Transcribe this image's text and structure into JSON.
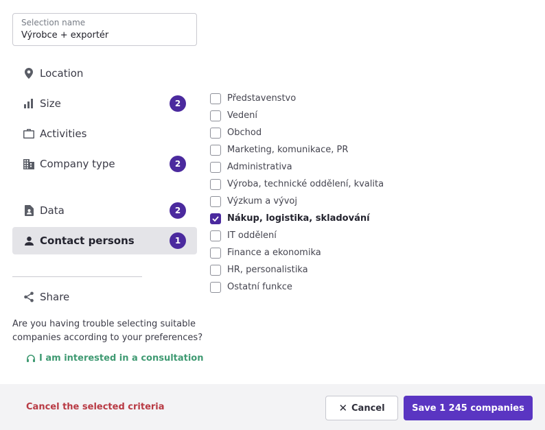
{
  "selection": {
    "label": "Selection name",
    "value": "Výrobce + exportér"
  },
  "nav": {
    "location": {
      "label": "Location",
      "icon": "location-pin-icon"
    },
    "size": {
      "label": "Size",
      "icon": "bar-chart-icon",
      "badge": "2"
    },
    "activities": {
      "label": "Activities",
      "icon": "briefcase-icon"
    },
    "company_type": {
      "label": "Company type",
      "icon": "building-icon",
      "badge": "2"
    },
    "data": {
      "label": "Data",
      "icon": "id-card-icon",
      "badge": "2"
    },
    "contact_persons": {
      "label": "Contact persons",
      "icon": "person-icon",
      "badge": "1",
      "active": true
    },
    "share": {
      "label": "Share",
      "icon": "share-icon"
    }
  },
  "help": {
    "text": "Are you having trouble selecting suitable companies according to your preferences?",
    "consult_label": "I am interested in a consultation"
  },
  "functions": [
    {
      "label": "Představenstvo",
      "checked": false
    },
    {
      "label": "Vedení",
      "checked": false
    },
    {
      "label": "Obchod",
      "checked": false
    },
    {
      "label": "Marketing, komunikace, PR",
      "checked": false
    },
    {
      "label": "Administrativa",
      "checked": false
    },
    {
      "label": "Výroba, technické oddělení, kvalita",
      "checked": false
    },
    {
      "label": "Výzkum a vývoj",
      "checked": false
    },
    {
      "label": "Nákup, logistika, skladování",
      "checked": true
    },
    {
      "label": "IT oddělení",
      "checked": false
    },
    {
      "label": "Finance a ekonomika",
      "checked": false
    },
    {
      "label": "HR, personalistika",
      "checked": false
    },
    {
      "label": "Ostatní funkce",
      "checked": false
    }
  ],
  "footer": {
    "cancel_criteria": "Cancel the selected criteria",
    "cancel": "Cancel",
    "save": "Save 1 245 companies"
  },
  "colors": {
    "accent": "#5a35c2",
    "badge": "#4b2a9e",
    "danger": "#b83a44",
    "consult": "#3f9a72"
  }
}
